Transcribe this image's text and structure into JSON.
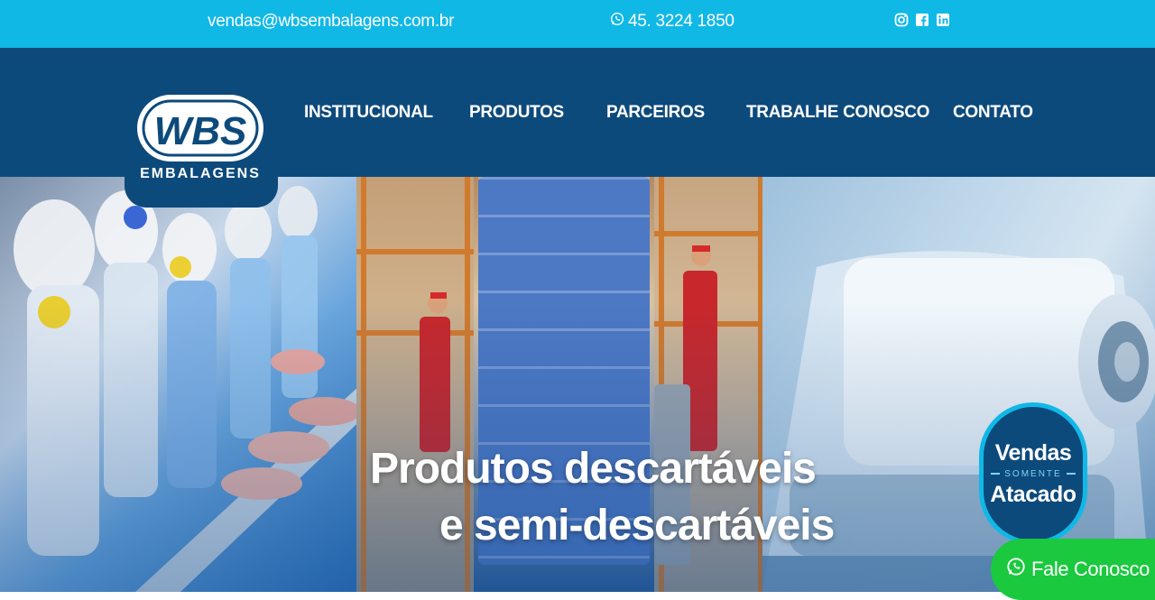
{
  "topbar": {
    "email": "vendas@wbsembalagens.com.br",
    "phone": "45. 3224 1850",
    "social": [
      "instagram-icon",
      "facebook-icon",
      "linkedin-icon"
    ],
    "background": "#10b8e6"
  },
  "header": {
    "logo_mark": "WBS",
    "logo_sub": "EMBALAGENS",
    "background": "#0d4a7c",
    "nav": [
      {
        "label": "INSTITUCIONAL"
      },
      {
        "label": "PRODUTOS"
      },
      {
        "label": "PARCEIROS"
      },
      {
        "label": "TRABALHE CONOSCO"
      },
      {
        "label": "CONTATO"
      }
    ]
  },
  "hero": {
    "line1": "Produtos descartáveis",
    "line2": "e semi-descartáveis",
    "badge": {
      "top": "Vendas",
      "middle": "SOMENTE",
      "bottom": "Atacado"
    }
  },
  "floating_button": {
    "label": "Fale Conosco",
    "color": "#1ac93e"
  }
}
